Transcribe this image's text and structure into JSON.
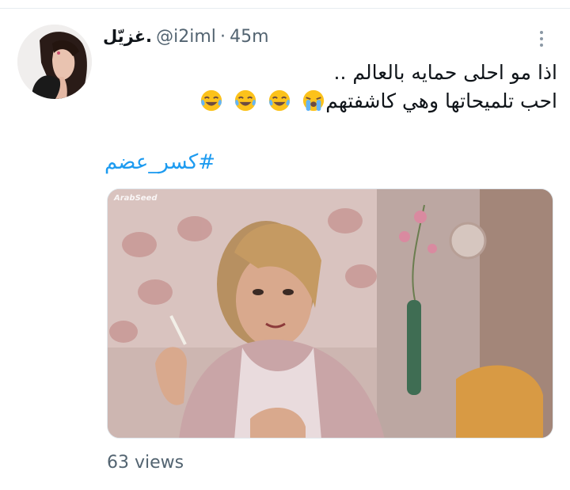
{
  "tweet": {
    "display_name": "غزيّل.",
    "handle": "@i2iml",
    "separator": "·",
    "time": "45m",
    "line1": "اذا مو احلى حمايه بالعالم ..",
    "line2": "احب تلميحاتها وهي كاشفتهم",
    "emojis": [
      "tears-of-joy",
      "tears-of-joy",
      "tears-of-joy",
      "loudly-crying"
    ],
    "hashtag": "#كسر_عضم",
    "media_watermark": "ArabSeed",
    "views": "63 views"
  },
  "colors": {
    "link": "#1d9bf0",
    "secondary_text": "#536471",
    "primary_text": "#0f1419",
    "emoji_face": "#fcc21b",
    "emoji_tears": "#64b5f6"
  }
}
